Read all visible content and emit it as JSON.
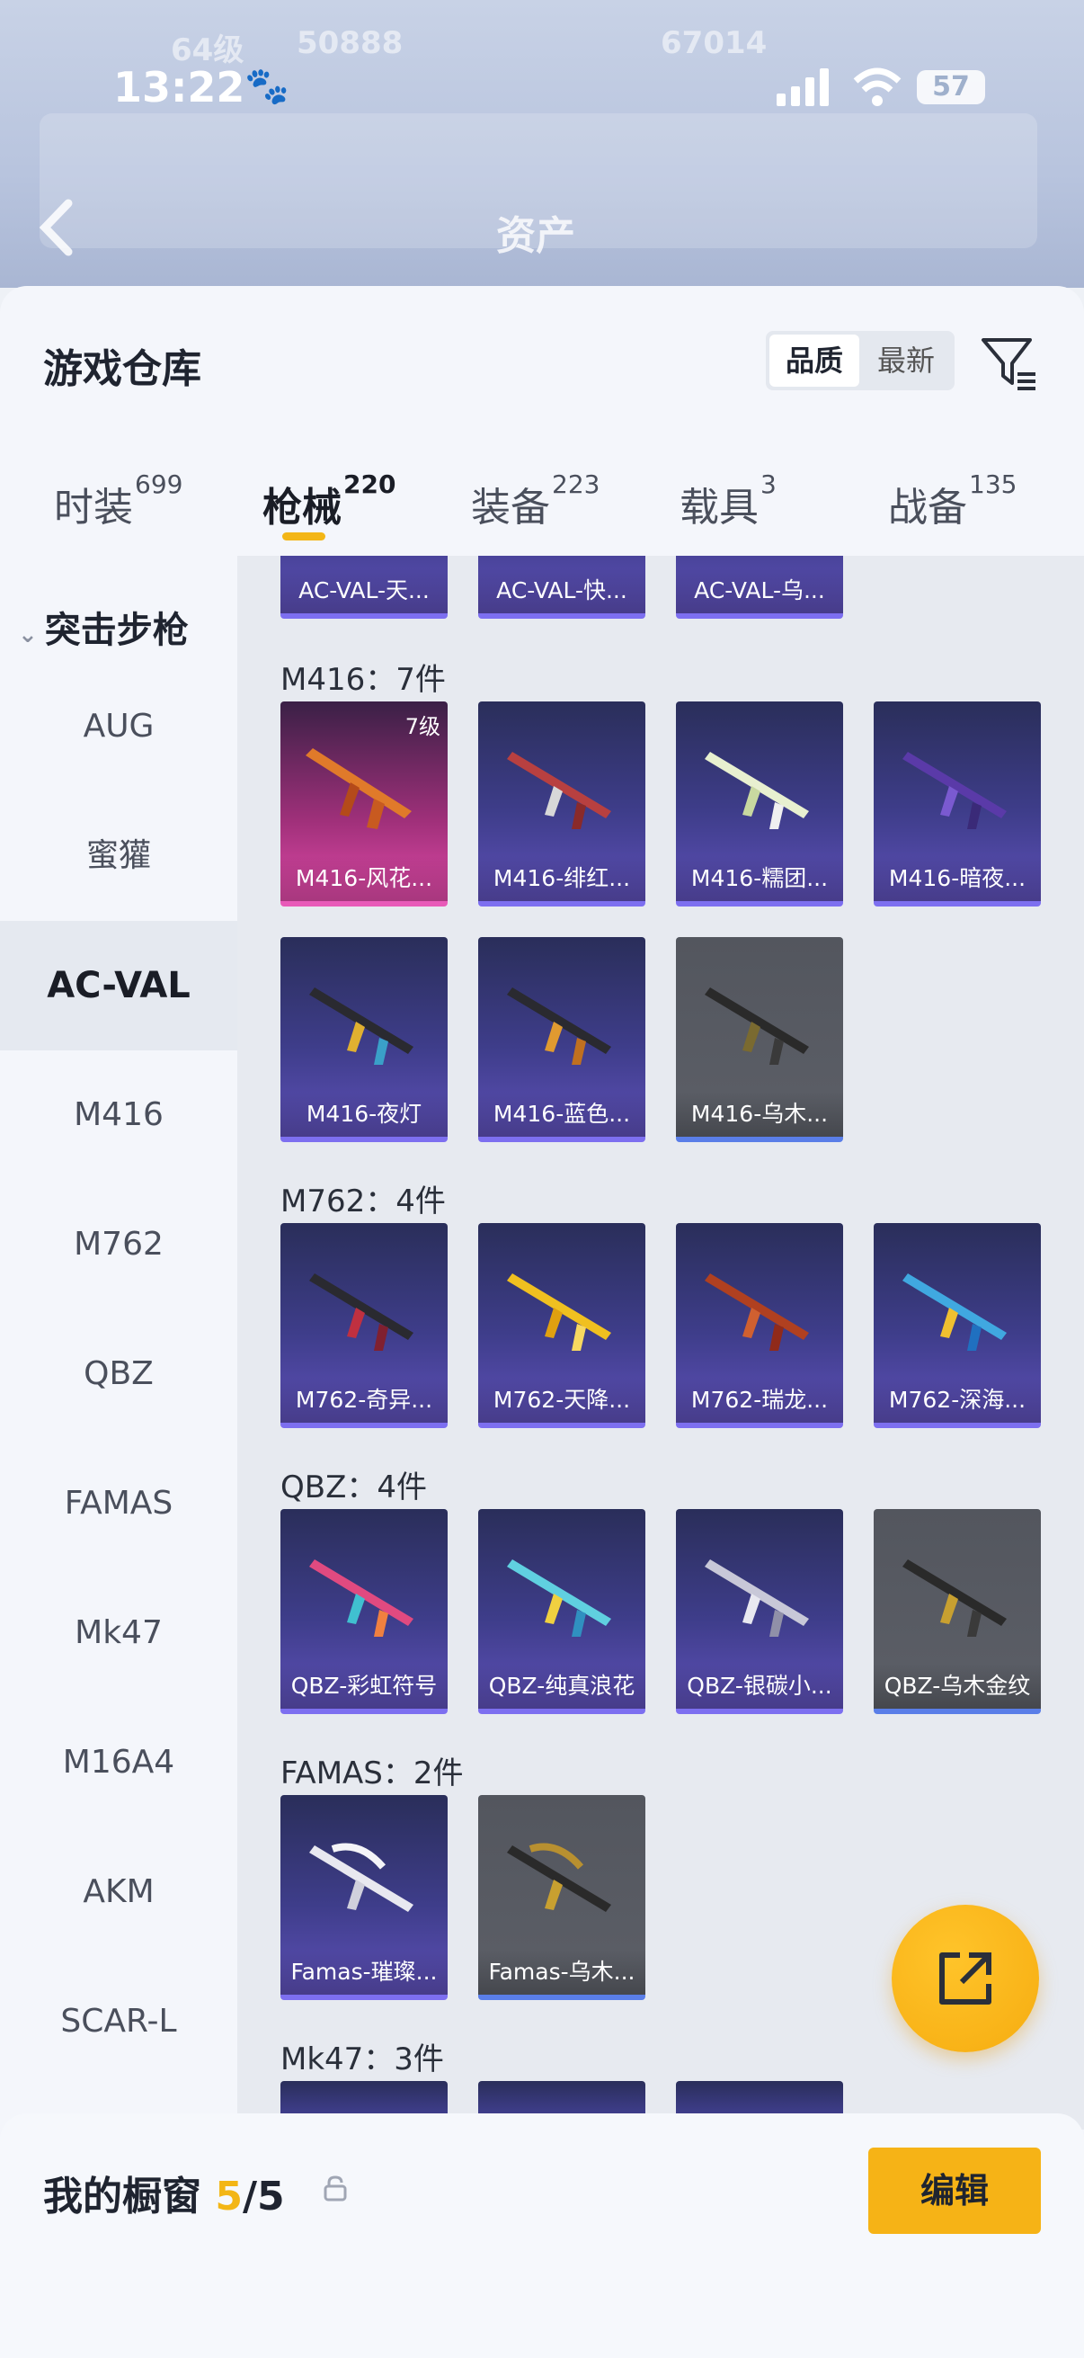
{
  "status_bar": {
    "time": "13:22",
    "battery": "57"
  },
  "background": {
    "level_text": "64级",
    "stat1": "50888",
    "stat2": "67014",
    "page_title": "资产"
  },
  "sheet": {
    "title": "游戏仓库",
    "sort_options": [
      "品质",
      "最新"
    ],
    "sort_selected": "品质"
  },
  "tabs": [
    {
      "label": "时装",
      "count": "699"
    },
    {
      "label": "枪械",
      "count": "220"
    },
    {
      "label": "装备",
      "count": "223"
    },
    {
      "label": "载具",
      "count": "3"
    },
    {
      "label": "战备",
      "count": "135"
    }
  ],
  "sidebar": {
    "group": "突击步枪",
    "items": [
      "AUG",
      "蜜獾",
      "AC-VAL",
      "M416",
      "M762",
      "QBZ",
      "FAMAS",
      "Mk47",
      "M16A4",
      "AKM",
      "SCAR-L"
    ],
    "active": "AC-VAL"
  },
  "groups": {
    "acval": {
      "items": [
        "AC-VAL-天...",
        "AC-VAL-快...",
        "AC-VAL-乌..."
      ]
    },
    "m416": {
      "label": "M416：7件",
      "level": "7级",
      "items": [
        "M416-风花...",
        "M416-绯红...",
        "M416-糯团...",
        "M416-暗夜...",
        "M416-夜灯",
        "M416-蓝色...",
        "M416-乌木..."
      ]
    },
    "m762": {
      "label": "M762：4件",
      "items": [
        "M762-奇异...",
        "M762-天降...",
        "M762-瑞龙...",
        "M762-深海..."
      ]
    },
    "qbz": {
      "label": "QBZ：4件",
      "items": [
        "QBZ-彩虹符号",
        "QBZ-纯真浪花",
        "QBZ-银碳小...",
        "QBZ-乌木金纹"
      ]
    },
    "famas": {
      "label": "FAMAS：2件",
      "items": [
        "Famas-璀璨...",
        "Famas-乌木..."
      ]
    },
    "mk47": {
      "label": "Mk47：3件"
    }
  },
  "bottom_bar": {
    "title": "我的橱窗",
    "count": "5",
    "total": "/5",
    "edit_label": "编辑"
  },
  "colors": {
    "accent": "#f3b616",
    "card_purple": "#3e3d8a",
    "card_pink": "#e04aa8",
    "card_grey": "#5c5f67"
  }
}
